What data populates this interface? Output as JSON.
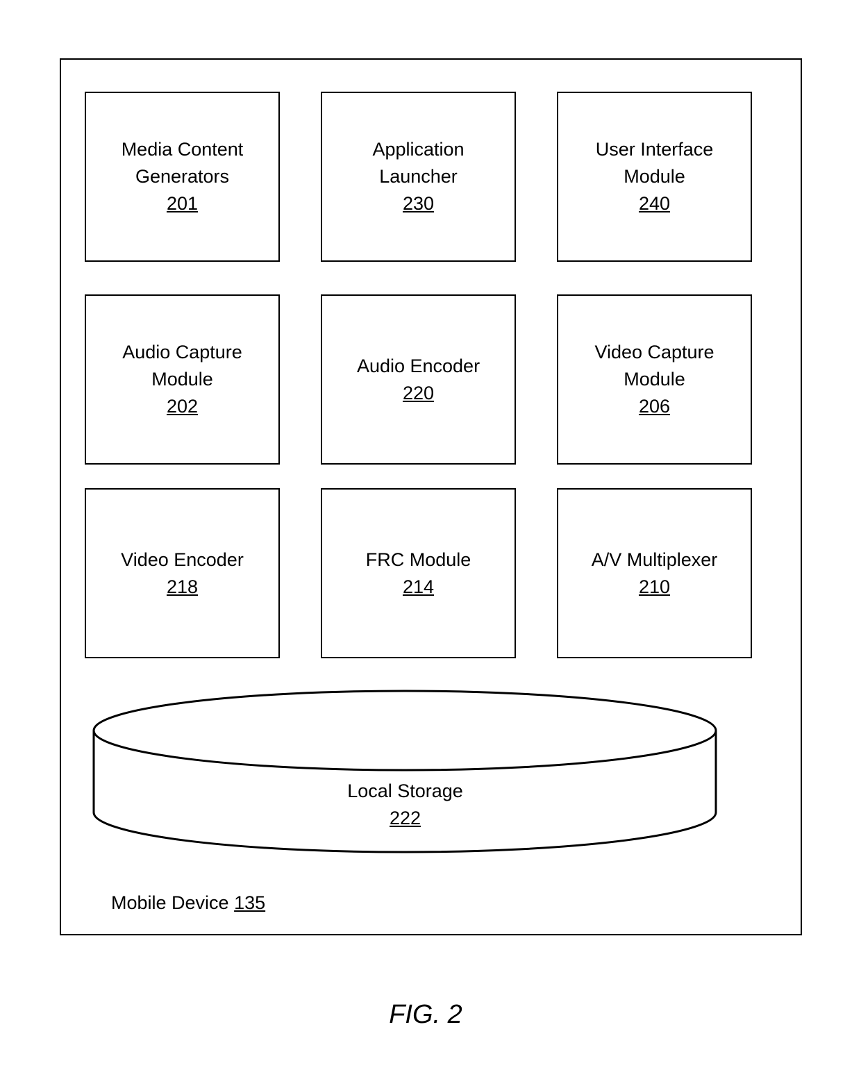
{
  "device": {
    "label": "Mobile Device",
    "number": "135"
  },
  "modules": [
    {
      "lines": [
        "Media Content",
        "Generators"
      ],
      "number": "201"
    },
    {
      "lines": [
        "Application",
        "Launcher"
      ],
      "number": "230"
    },
    {
      "lines": [
        "User Interface",
        "Module"
      ],
      "number": "240"
    },
    {
      "lines": [
        "Audio Capture",
        "Module"
      ],
      "number": "202"
    },
    {
      "lines": [
        "Audio Encoder"
      ],
      "number": "220"
    },
    {
      "lines": [
        "Video Capture",
        "Module"
      ],
      "number": "206"
    },
    {
      "lines": [
        "Video Encoder"
      ],
      "number": "218"
    },
    {
      "lines": [
        "FRC Module"
      ],
      "number": "214"
    },
    {
      "lines": [
        "A/V Multiplexer"
      ],
      "number": "210"
    }
  ],
  "storage": {
    "label": "Local Storage",
    "number": "222"
  },
  "figure_caption": "FIG. 2"
}
